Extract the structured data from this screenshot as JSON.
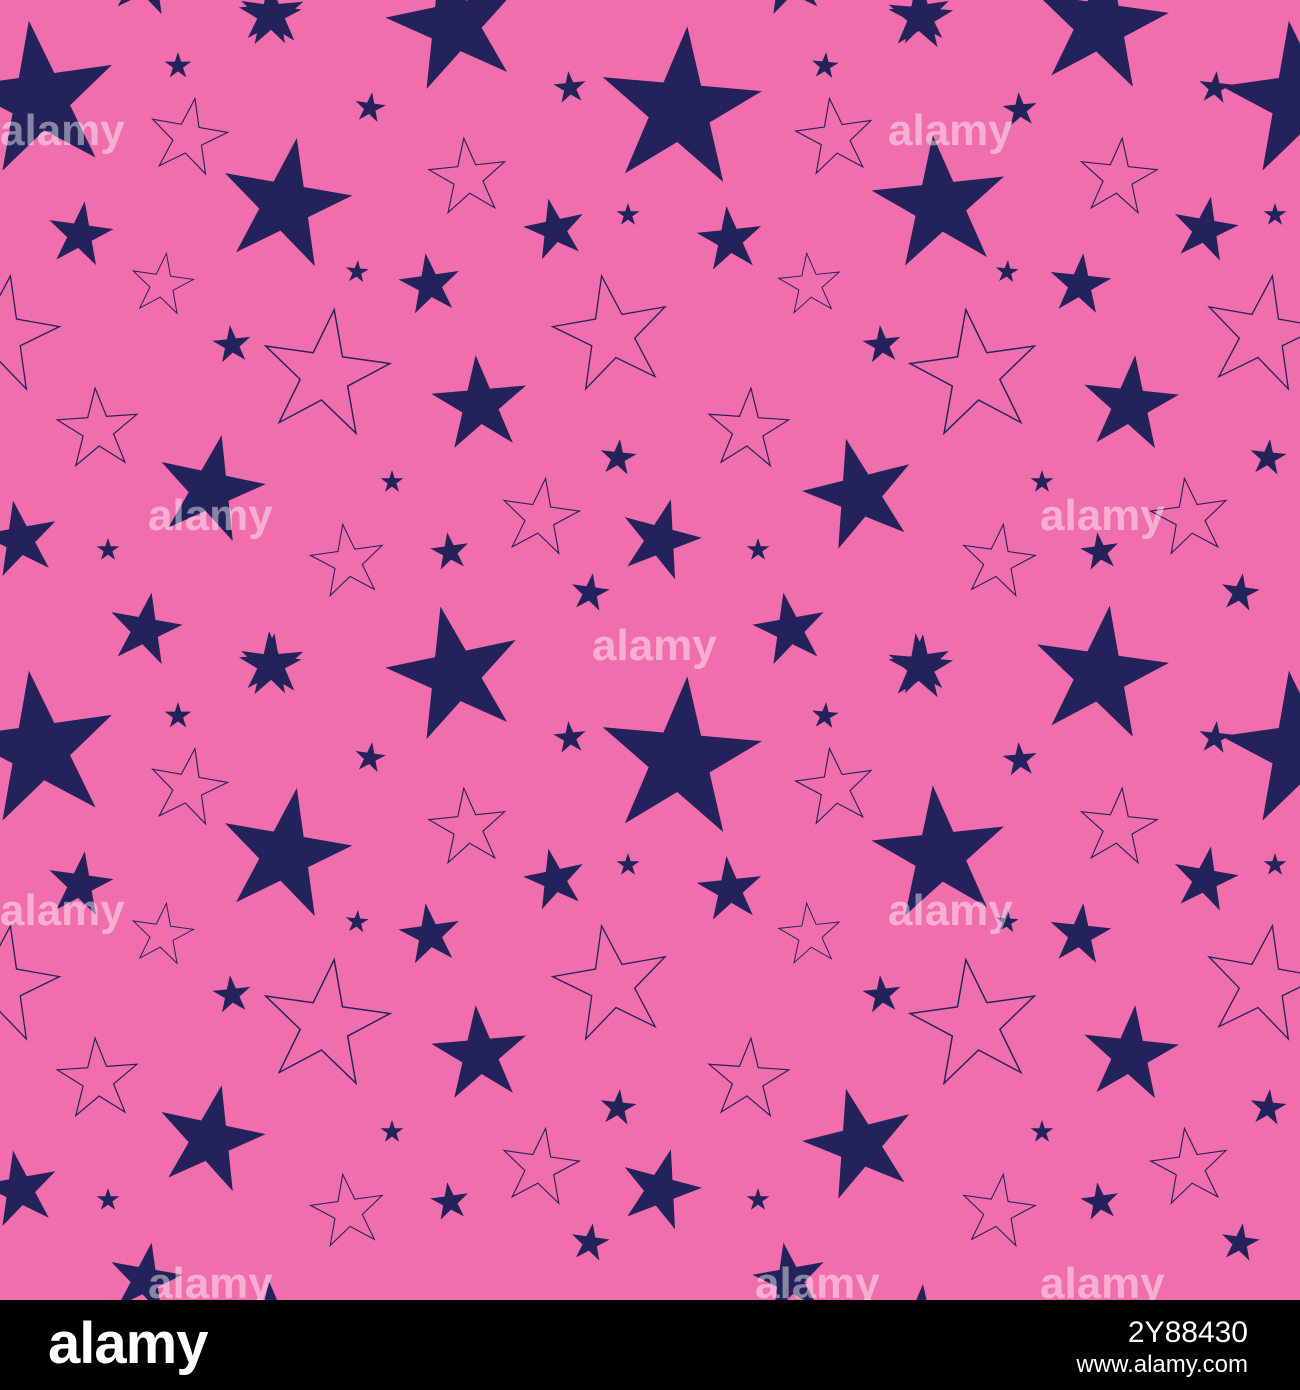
{
  "colors": {
    "background": "#f06eab",
    "star": "#24225a",
    "footer": "#000000",
    "footer_text": "#ffffff"
  },
  "pattern": {
    "description_icon": "star-icon",
    "style": "seamless star pattern"
  },
  "watermark": {
    "text": "alamy"
  },
  "footer": {
    "brand": "alamy",
    "image_id": "2Y88430",
    "site": "www.alamy.com"
  }
}
